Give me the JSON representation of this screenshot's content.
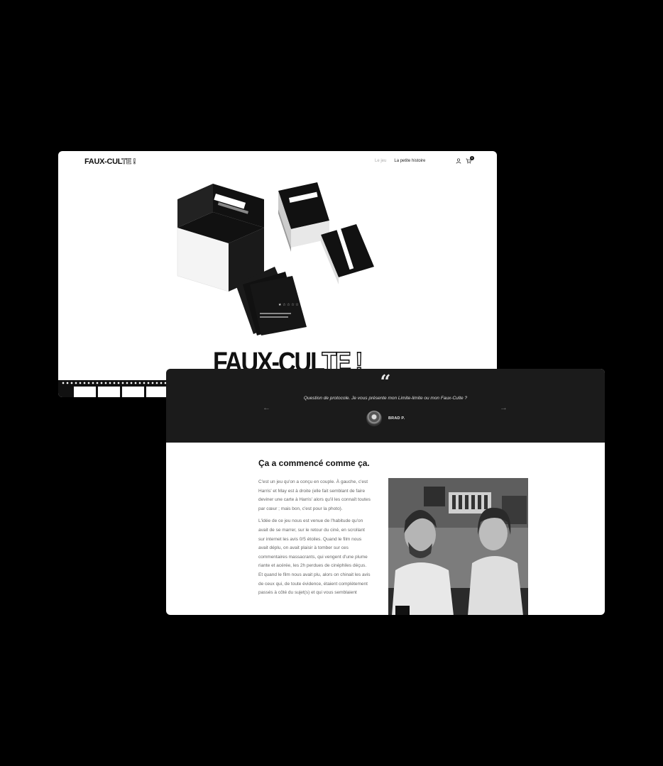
{
  "back_page": {
    "logo": {
      "solid": "FAUX-CUL",
      "outline": "TE !"
    },
    "nav": {
      "item1": "Le jeu",
      "item2": "La petite histoire"
    },
    "cart_count": "0",
    "hero": {
      "solid": "FAUX-CUL",
      "outline": "TE !"
    },
    "product_image_alt": "Faux-Culte card game boxes and cards"
  },
  "front_page": {
    "testimonial": {
      "quote_mark": "“",
      "text": "Question de protocole. Je vous présente mon Limite-limite ou mon Faux-Culte ?",
      "author": "BRAD P.",
      "prev_arrow": "←",
      "next_arrow": "→"
    },
    "story": {
      "title": "Ça a commencé comme ça.",
      "paragraphs": [
        "C'est un jeu qu'on a conçu en couple. À gauche, c'est Harris' et May est à droite (elle fait semblant de faire deviner une carte à Harris' alors qu'il les connaît toutes par cœur ; mais bon, c'est pour la photo).",
        "L'idée de ce jeu nous est venue de l'habitude qu'on avait de se marrer, sur le retour du ciné, en scrollant sur internet les avis 0/5 étoiles. Quand le film nous avait déplu, on avait plaisir à tomber sur ces commentaires massacrants, qui vengent d'une plume riante et acérée, les 2h perdues de cinéphiles déçus. Et quand le film nous avait plu, alors on chinait les avis de ceux qui, de toute évidence, étaient complètement passés à côté du sujet(s) et qui vous semblaient"
      ]
    }
  },
  "colors": {
    "background": "#000000",
    "dark_band": "#1b1b1b",
    "card": "#ffffff"
  }
}
